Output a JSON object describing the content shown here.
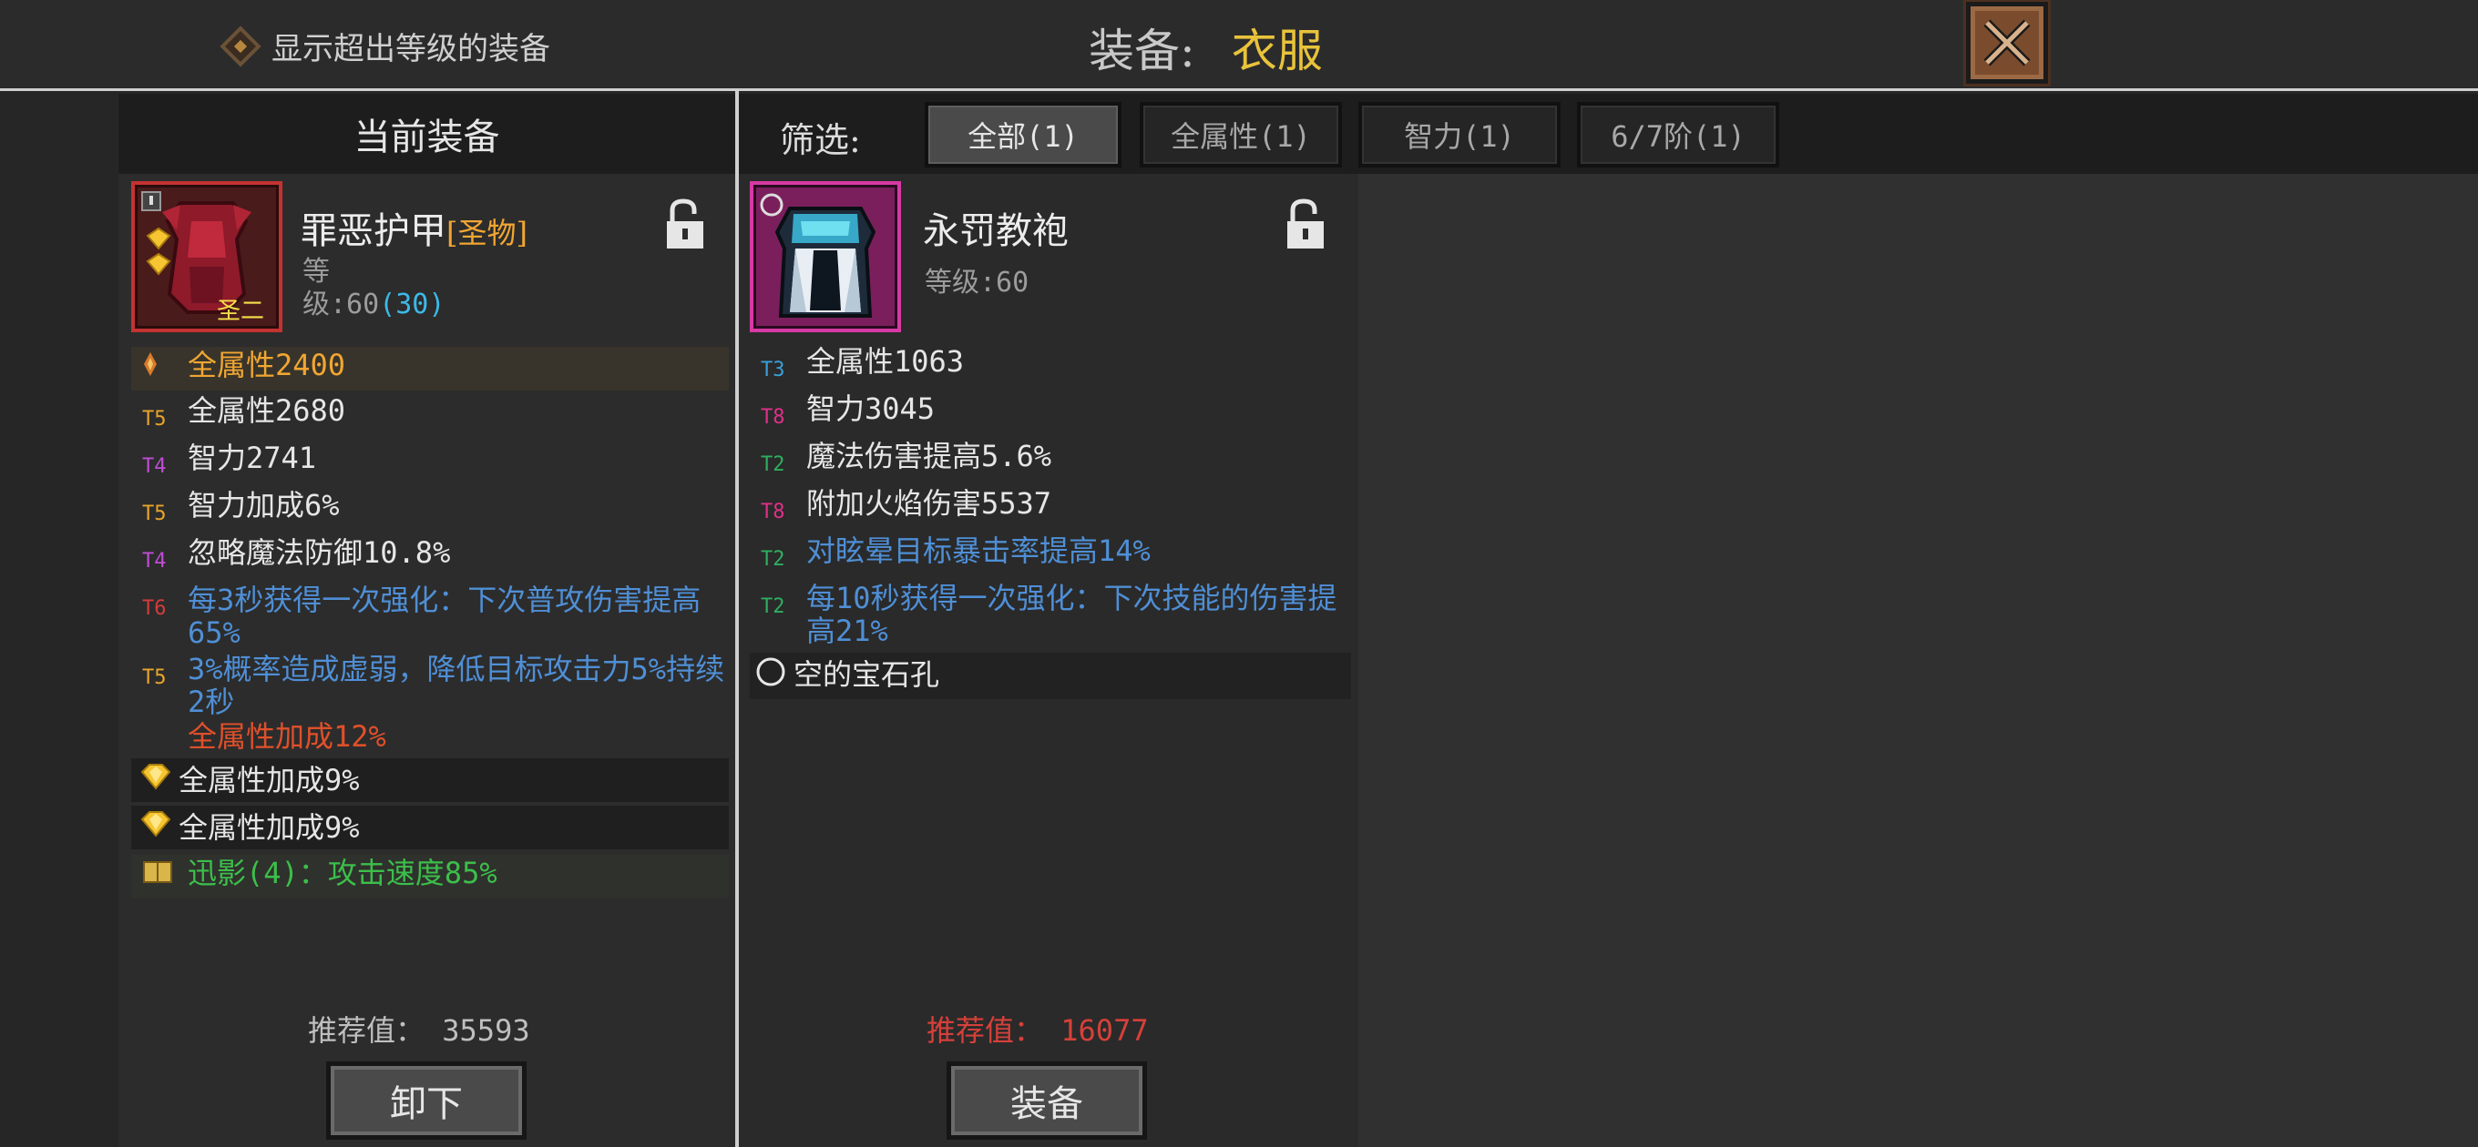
{
  "topbar": {
    "show_over_level": "显示超出等级的装备",
    "title_prefix": "装备:",
    "title_slot": "衣服",
    "close_icon": "close-x-icon"
  },
  "current": {
    "header": "当前装备",
    "name": "罪恶护甲",
    "tag": "[圣物]",
    "badge": "圣二",
    "level_label": "等",
    "level_value": "级:60",
    "level_extra": "(30)",
    "main_stat": "全属性2400",
    "stats": [
      {
        "tier": "T5",
        "text": "全属性2680",
        "color": "#e6e6e6",
        "tier_color": "#e8a52a"
      },
      {
        "tier": "T4",
        "text": "智力2741",
        "color": "#e6e6e6",
        "tier_color": "#c04dd6"
      },
      {
        "tier": "T5",
        "text": "智力加成6%",
        "color": "#e6e6e6",
        "tier_color": "#e8a52a"
      },
      {
        "tier": "T4",
        "text": "忽略魔法防御10.8%",
        "color": "#e6e6e6",
        "tier_color": "#c04dd6"
      },
      {
        "tier": "T6",
        "text": "每3秒获得一次强化：下次普攻伤害提高65%",
        "color": "#4f8fd6",
        "tier_color": "#d63b3b"
      },
      {
        "tier": "T5",
        "text": "3%概率造成虚弱，降低目标攻击力5%持续2秒",
        "color": "#4f8fd6",
        "tier_color": "#e8a52a"
      }
    ],
    "special_stat": "全属性加成12%",
    "gem_stats": [
      "全属性加成9%",
      "全属性加成9%"
    ],
    "set_bonus": "迅影(4)：攻击速度85%",
    "recommend": "推荐值：  35593",
    "unequip": "卸下"
  },
  "filters": {
    "label": "筛选:",
    "tabs": [
      "全部(1)",
      "全属性(1)",
      "智力(1)",
      "6/7阶(1)"
    ]
  },
  "candidate": {
    "name": "永罚教袍",
    "level": "等级:60",
    "stats": [
      {
        "tier": "T3",
        "text": "全属性1063",
        "color": "#e6e6e6",
        "tier_color": "#3aa0d8"
      },
      {
        "tier": "T8",
        "text": "智力3045",
        "color": "#e6e6e6",
        "tier_color": "#e0308a"
      },
      {
        "tier": "T2",
        "text": "魔法伤害提高5.6%",
        "color": "#e6e6e6",
        "tier_color": "#2fae5f"
      },
      {
        "tier": "T8",
        "text": "附加火焰伤害5537",
        "color": "#e6e6e6",
        "tier_color": "#e0308a"
      },
      {
        "tier": "T2",
        "text": "对眩晕目标暴击率提高14%",
        "color": "#4f8fd6",
        "tier_color": "#2fae5f"
      },
      {
        "tier": "T2",
        "text": "每10秒获得一次强化：下次技能的伤害提高21%",
        "color": "#4f8fd6",
        "tier_color": "#2fae5f"
      }
    ],
    "socket": "空的宝石孔",
    "recommend": "推荐值：  16077",
    "equip": "装备"
  }
}
